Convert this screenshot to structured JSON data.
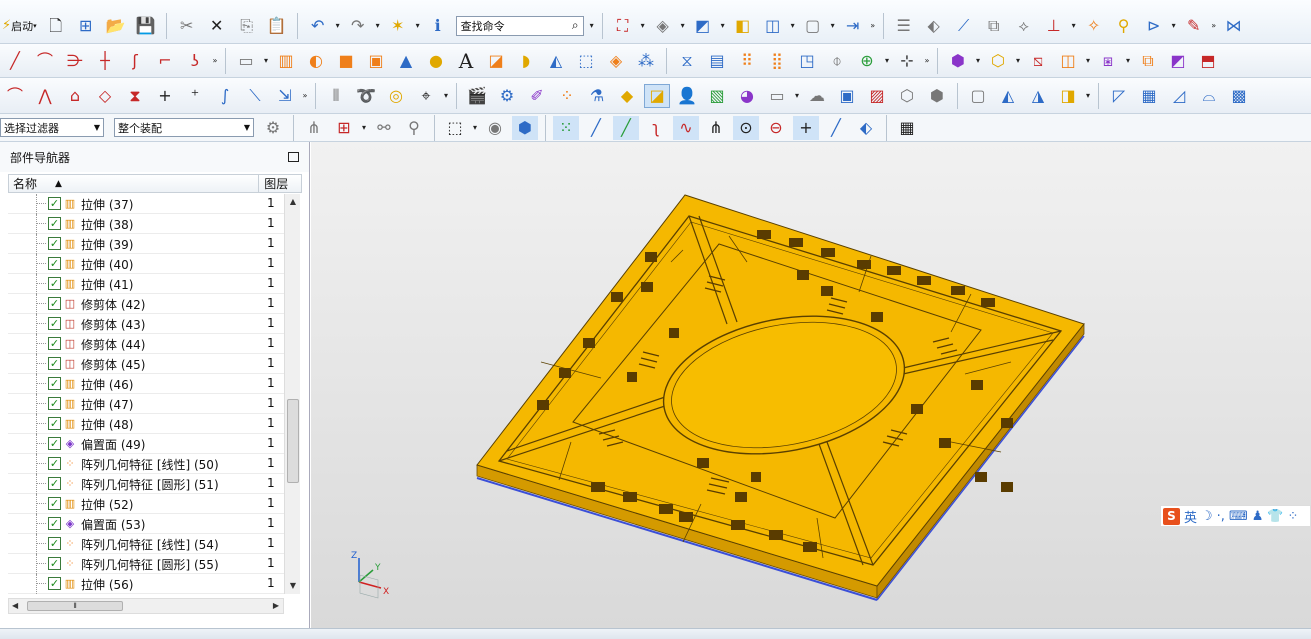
{
  "toolbar": {
    "start_label": "启动",
    "search_placeholder": "查找命令",
    "selection_filter": "选择过滤器",
    "assembly_scope": "整个装配"
  },
  "navigator": {
    "title": "部件导航器",
    "col_name": "名称",
    "col_layer": "图层",
    "rows": [
      {
        "label": "拉伸 (37)",
        "layer": "1",
        "icon": "extrude-icon"
      },
      {
        "label": "拉伸 (38)",
        "layer": "1",
        "icon": "extrude-icon"
      },
      {
        "label": "拉伸 (39)",
        "layer": "1",
        "icon": "extrude-icon"
      },
      {
        "label": "拉伸 (40)",
        "layer": "1",
        "icon": "extrude-icon"
      },
      {
        "label": "拉伸 (41)",
        "layer": "1",
        "icon": "extrude-icon"
      },
      {
        "label": "修剪体 (42)",
        "layer": "1",
        "icon": "trim-body-icon"
      },
      {
        "label": "修剪体 (43)",
        "layer": "1",
        "icon": "trim-body-icon"
      },
      {
        "label": "修剪体 (44)",
        "layer": "1",
        "icon": "trim-body-icon"
      },
      {
        "label": "修剪体 (45)",
        "layer": "1",
        "icon": "trim-body-icon"
      },
      {
        "label": "拉伸 (46)",
        "layer": "1",
        "icon": "extrude-icon"
      },
      {
        "label": "拉伸 (47)",
        "layer": "1",
        "icon": "extrude-icon"
      },
      {
        "label": "拉伸 (48)",
        "layer": "1",
        "icon": "extrude-icon"
      },
      {
        "label": "偏置面 (49)",
        "layer": "1",
        "icon": "offset-face-icon"
      },
      {
        "label": "阵列几何特征 [线性] (50)",
        "layer": "1",
        "icon": "pattern-geometry-icon"
      },
      {
        "label": "阵列几何特征 [圆形] (51)",
        "layer": "1",
        "icon": "pattern-geometry-icon"
      },
      {
        "label": "拉伸 (52)",
        "layer": "1",
        "icon": "extrude-icon"
      },
      {
        "label": "偏置面 (53)",
        "layer": "1",
        "icon": "offset-face-icon"
      },
      {
        "label": "阵列几何特征 [线性] (54)",
        "layer": "1",
        "icon": "pattern-geometry-icon"
      },
      {
        "label": "阵列几何特征 [圆形] (55)",
        "layer": "1",
        "icon": "pattern-geometry-icon"
      },
      {
        "label": "拉伸 (56)",
        "layer": "1",
        "icon": "extrude-icon"
      }
    ]
  },
  "triad": {
    "z": "Z",
    "y": "Y",
    "x": "X"
  },
  "ime": {
    "lang": "英",
    "logo": "S"
  },
  "colors": {
    "model_top": "#f5b800",
    "model_side": "#d99e00",
    "viewport_bg": "#e2e2e2",
    "checkbox_green": "#1a8a1a"
  }
}
